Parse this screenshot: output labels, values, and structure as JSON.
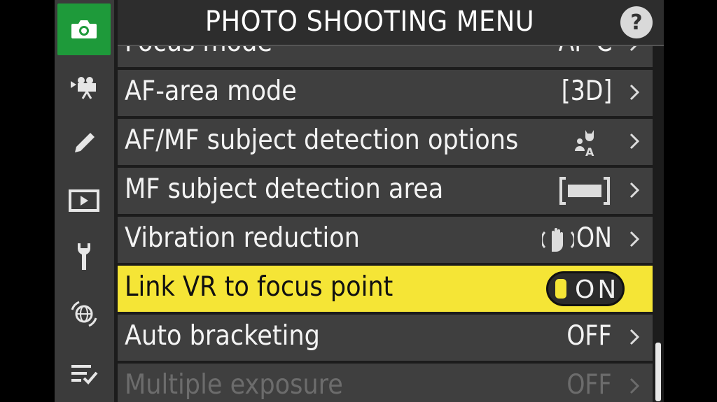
{
  "menu": {
    "title": "PHOTO SHOOTING MENU",
    "help_label": "?"
  },
  "sidebar": {
    "items": [
      {
        "icon": "camera-icon",
        "active": true
      },
      {
        "icon": "movie-camera-icon",
        "active": false
      },
      {
        "icon": "pencil-icon",
        "active": false
      },
      {
        "icon": "playback-icon",
        "active": false
      },
      {
        "icon": "wrench-icon",
        "active": false
      },
      {
        "icon": "network-icon",
        "active": false
      },
      {
        "icon": "my-menu-icon",
        "active": false
      }
    ]
  },
  "rows": [
    {
      "label": "Focus mode",
      "value": "AF-C",
      "state": "partial"
    },
    {
      "label": "AF-area mode",
      "value": "[3D]",
      "state": "normal"
    },
    {
      "label": "AF/MF subject detection options",
      "value": "",
      "value_icon": "subject-detection-auto-icon",
      "state": "normal"
    },
    {
      "label": "MF subject detection area",
      "value": "",
      "value_icon": "detection-area-wide-icon",
      "state": "normal"
    },
    {
      "label": "Vibration reduction",
      "value": "ON",
      "value_icon": "vr-hand-icon",
      "state": "normal"
    },
    {
      "label": "Link VR to focus point",
      "value": "ON",
      "state": "selected"
    },
    {
      "label": "Auto bracketing",
      "value": "OFF",
      "state": "normal"
    },
    {
      "label": "Multiple exposure",
      "value": "OFF",
      "state": "disabled"
    }
  ],
  "colors": {
    "accent_green": "#1e9a3a",
    "highlight_yellow": "#f5e536",
    "row_bg": "#3f3f3f"
  }
}
